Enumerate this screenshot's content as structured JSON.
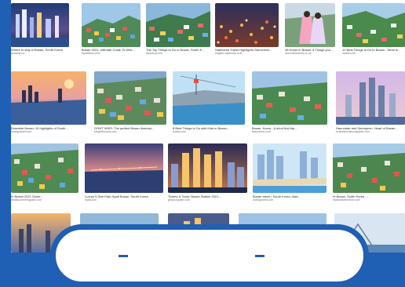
{
  "page_background": "#1f5fb4",
  "frame_background": "#ffffff",
  "results": {
    "row1": [
      {
        "caption": "Where to stay in Busan, South Korea",
        "source": "aodarav.co"
      },
      {
        "caption": "Busan 2021: Ultimate Guide To Whe...",
        "source": "tripadvisor.com"
      },
      {
        "caption": "The Top Things to Do in Busan, South K...",
        "source": "tripsavvy.com"
      },
      {
        "caption": "VisitKorea Travel Highlights Gamcheon...",
        "source": "english.visitkorea.or.kr"
      },
      {
        "caption": "48 Hours in Busan: 8 Things you...",
        "source": "aroundtheworld.co.uk"
      },
      {
        "caption": "12 Best Things to Do in Busan - What is...",
        "source": "hotels.com"
      }
    ],
    "row2": [
      {
        "caption": "Essential Busan: 10 highlights of South...",
        "source": "lonelyplanet.com"
      },
      {
        "caption": "DON'T MISS: The perfect Busan itinerary...",
        "source": "wegotthisnow.com"
      },
      {
        "caption": "8 Best Things to Do with Kids in Busan...",
        "source": "hotels.com"
      },
      {
        "caption": "Busan, Korea - A short first trip...",
        "source": "barcelover.com"
      },
      {
        "caption": "Haeundae and Seomyeon: Heart of Busan...",
        "source": "kobeinternationalguide.com"
      }
    ],
    "row3": [
      {
        "caption": "In Busan 2021 Guide...",
        "source": "thediscoverersguide.com"
      },
      {
        "caption": "Luxury 5-Star Park Hyatt Busan, South Korea",
        "source": "hyatt.com"
      },
      {
        "caption": "Tickets & Tours: Busan Station 2021...",
        "source": "getyourguide.com"
      },
      {
        "caption": "Busan travel | South Korea, Asia...",
        "source": "lonelyplanet.com"
      },
      {
        "caption": "In Busan, South Korea -...",
        "source": "stockbetweenone.com"
      }
    ]
  }
}
